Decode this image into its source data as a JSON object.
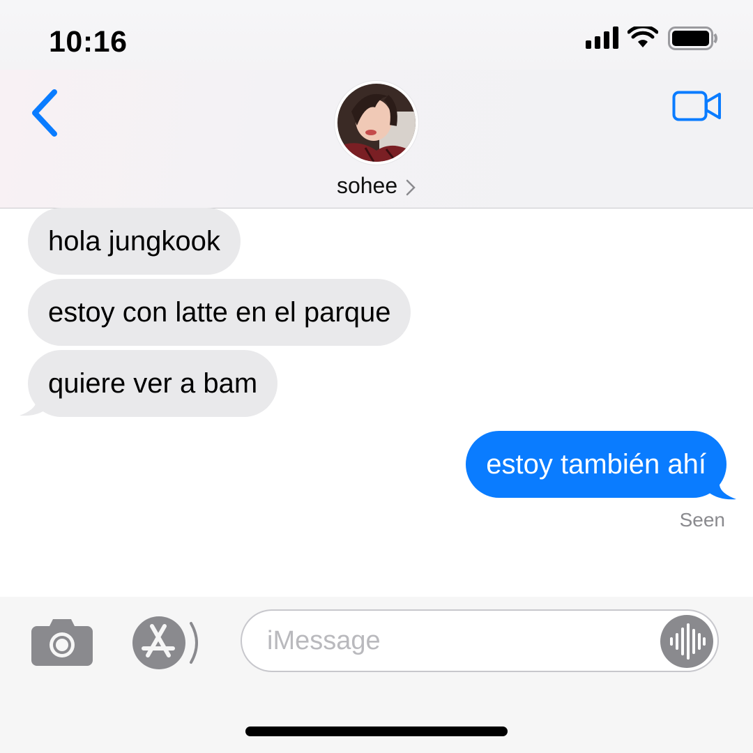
{
  "status_bar": {
    "time": "10:16",
    "icons": [
      "cellular-signal-icon",
      "wifi-icon",
      "battery-icon"
    ]
  },
  "header": {
    "contact_name": "sohee",
    "back_icon": "chevron-left-icon",
    "video_icon": "video-camera-icon",
    "accent_color": "#0a7cff"
  },
  "messages": [
    {
      "direction": "received",
      "text": "hola jungkook"
    },
    {
      "direction": "received",
      "text": "estoy con latte en el parque"
    },
    {
      "direction": "received",
      "text": "quiere ver a bam"
    },
    {
      "direction": "sent",
      "text": "estoy también ahí"
    }
  ],
  "read_receipt": "Seen",
  "composer": {
    "placeholder": "iMessage",
    "camera_icon": "camera-icon",
    "apps_icon": "app-store-icon",
    "dictation_icon": "waveform-icon"
  },
  "colors": {
    "sent_bubble": "#0a7cff",
    "received_bubble": "#e9e9eb",
    "receipt_text": "#8a8a8e"
  }
}
